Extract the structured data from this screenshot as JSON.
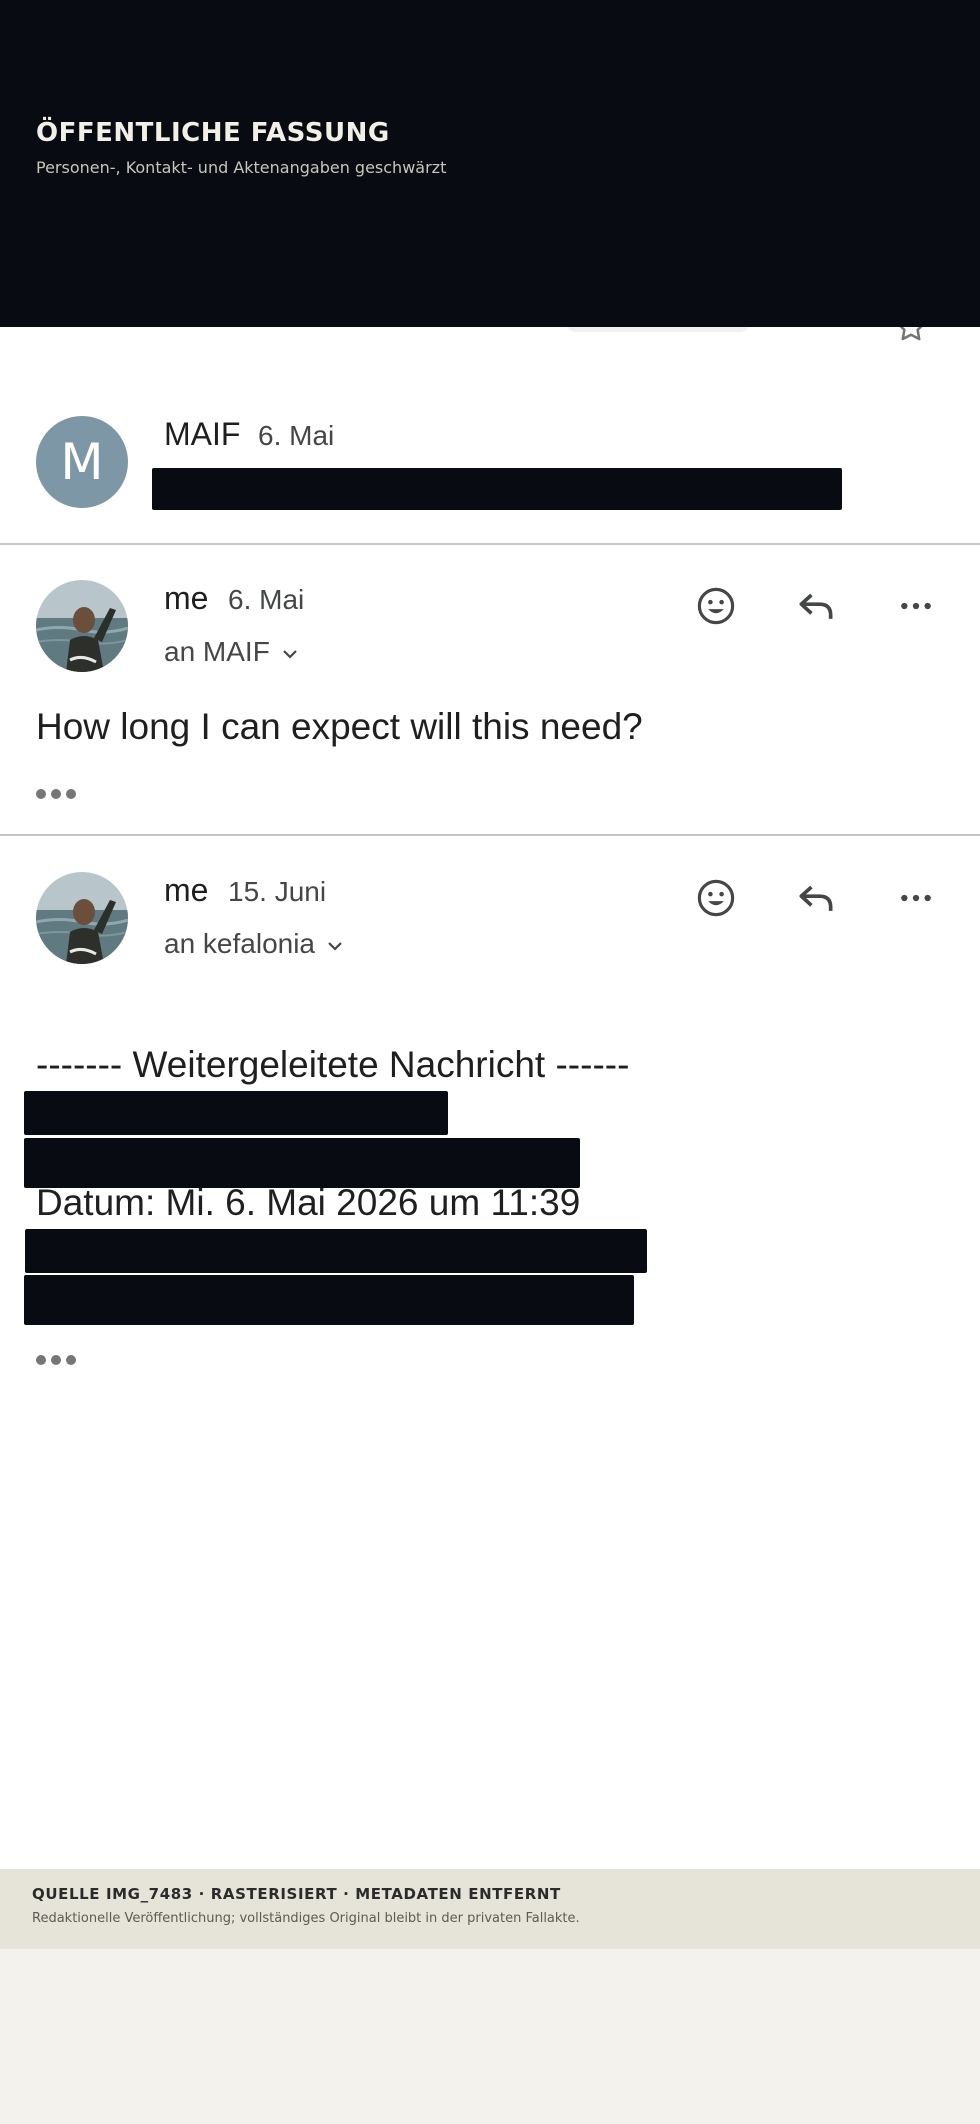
{
  "banner": {
    "title": "ÖFFENTLICHE FASSUNG",
    "subtitle": "Personen-, Kontakt- und Aktenangaben geschwärzt"
  },
  "messages": [
    {
      "sender": "MAIF",
      "avatar_letter": "M",
      "date": "6. Mai"
    },
    {
      "sender": "me",
      "date": "6. Mai",
      "recipient": "an MAIF",
      "body": "How long I can expect will this need?"
    },
    {
      "sender": "me",
      "date": "15. Juni",
      "recipient": "an kefalonia",
      "forward_header": "------- Weitergeleitete Nachricht ------",
      "forward_date": "Datum: Mi. 6. Mai 2026 um 11:39"
    }
  ],
  "icons": {
    "emoji": "smiley-icon",
    "reply": "reply-icon",
    "more": "more-vert-icon",
    "expand": "chevron-down-icon",
    "star": "star-icon",
    "quoted": "ellipsis-icon"
  },
  "footer": {
    "title": "QUELLE IMG_7483 · RASTERISIERT · METADATEN ENTFERNT",
    "note": "Redaktionelle Veröffentlichung; vollständiges Original bleibt in der privaten Fallakte."
  },
  "colors": {
    "redaction": "#080c12",
    "avatar_m": "#7d97a6",
    "banner_bg": "#080c12",
    "footer_bg": "#e6e3d8"
  }
}
